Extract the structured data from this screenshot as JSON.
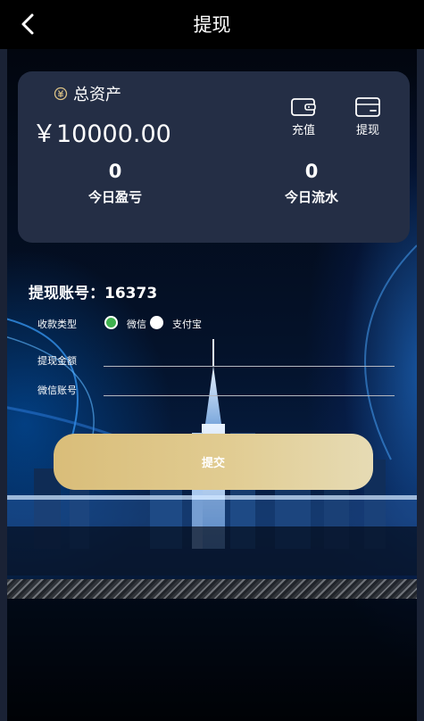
{
  "header": {
    "title": "提现"
  },
  "card": {
    "asset_label": "总资产",
    "balance": "￥10000.00",
    "actions": [
      {
        "label": "充值"
      },
      {
        "label": "提现"
      }
    ],
    "stats": [
      {
        "value": "0",
        "label": "今日盈亏"
      },
      {
        "value": "0",
        "label": "今日流水"
      }
    ]
  },
  "form": {
    "account_text": "提现账号：16373",
    "payment_type_label": "收款类型",
    "payment_options": [
      {
        "label": "微信",
        "selected": true
      },
      {
        "label": "支付宝",
        "selected": false
      }
    ],
    "amount_label": "提现金额",
    "amount_value": "",
    "wechat_account_label": "微信账号",
    "wechat_account_value": "",
    "submit_label": "提交"
  },
  "colors": {
    "card_bg": "#242e45",
    "accent_gold": "#dcc386",
    "radio_selected": "#3fb14f"
  }
}
